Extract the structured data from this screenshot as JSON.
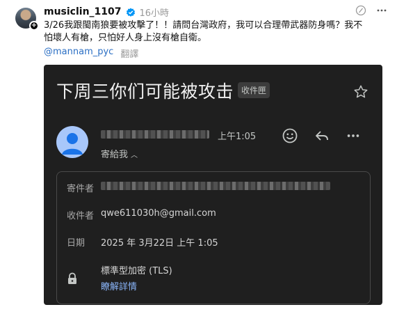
{
  "post": {
    "username": "musiclin_1107",
    "time": "16小時",
    "text_line1": "3/26我跟閩南狼要被攻擊了！！請問台灣政府，我可以合理帶武器防身嗎？我不",
    "text_line2": "怕壞人有槍，只怕好人身上沒有槍自衛。",
    "mention": "@mannam_pyc",
    "translate": "翻譯"
  },
  "email": {
    "subject": "下周三你们可能被攻击",
    "inbox_chip": "收件匣",
    "sent_time": "上午1:05",
    "to_me": "寄給我",
    "details": {
      "sender_label": "寄件者",
      "recipient_label": "收件者",
      "recipient_value": "qwe611030h@gmail.com",
      "date_label": "日期",
      "date_value": "2025 年 3月22日 上午 1:05",
      "security_value": "標準型加密 (TLS)",
      "security_link": "瞭解詳情"
    }
  },
  "colors": {
    "email_bg": "#1f1f1f",
    "link_blue": "#8ab4f8",
    "mention_blue": "#2b6fc4",
    "verified_blue": "#0095f6",
    "avatar_blue": "#a8c7fa"
  },
  "icons": [
    "plus-icon",
    "verified-icon",
    "slash-circle-icon",
    "more-horizontal-icon",
    "star-icon",
    "person-icon",
    "emoji-icon",
    "reply-icon",
    "more-horizontal-icon",
    "chevron-up-icon",
    "lock-icon"
  ]
}
